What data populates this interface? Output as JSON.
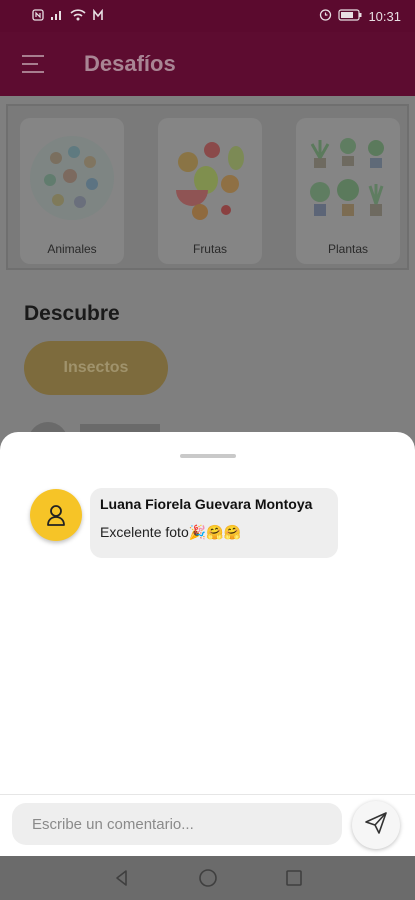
{
  "status_bar": {
    "time": "10:31",
    "left_icons": [
      "nfc-icon",
      "signal-icon",
      "wifi-icon",
      "notification-icon"
    ],
    "right_icons": [
      "alarm-icon",
      "battery-icon"
    ]
  },
  "app_bar": {
    "title": "Desafíos",
    "menu_icon": "hamburger-menu-icon"
  },
  "categories": [
    {
      "label": "Animales",
      "icon": "animals-illustration"
    },
    {
      "label": "Frutas",
      "icon": "fruits-illustration"
    },
    {
      "label": "Plantas",
      "icon": "plants-illustration"
    }
  ],
  "discover": {
    "heading": "Descubre",
    "chip": "Insectos"
  },
  "comments_sheet": {
    "comments": [
      {
        "author": "Luana Fiorela Guevara Montoya",
        "text": "Excelente foto🎉🤗🤗",
        "avatar_icon": "user-avatar-icon"
      }
    ],
    "input_placeholder": "Escribe un comentario...",
    "send_icon": "send-icon"
  },
  "nav_bar": {
    "buttons": [
      "back-icon",
      "home-icon",
      "recents-icon"
    ]
  },
  "colors": {
    "app_bar": "#5d0c30",
    "accent_yellow": "#f6c427",
    "bubble": "#eeeeee"
  }
}
